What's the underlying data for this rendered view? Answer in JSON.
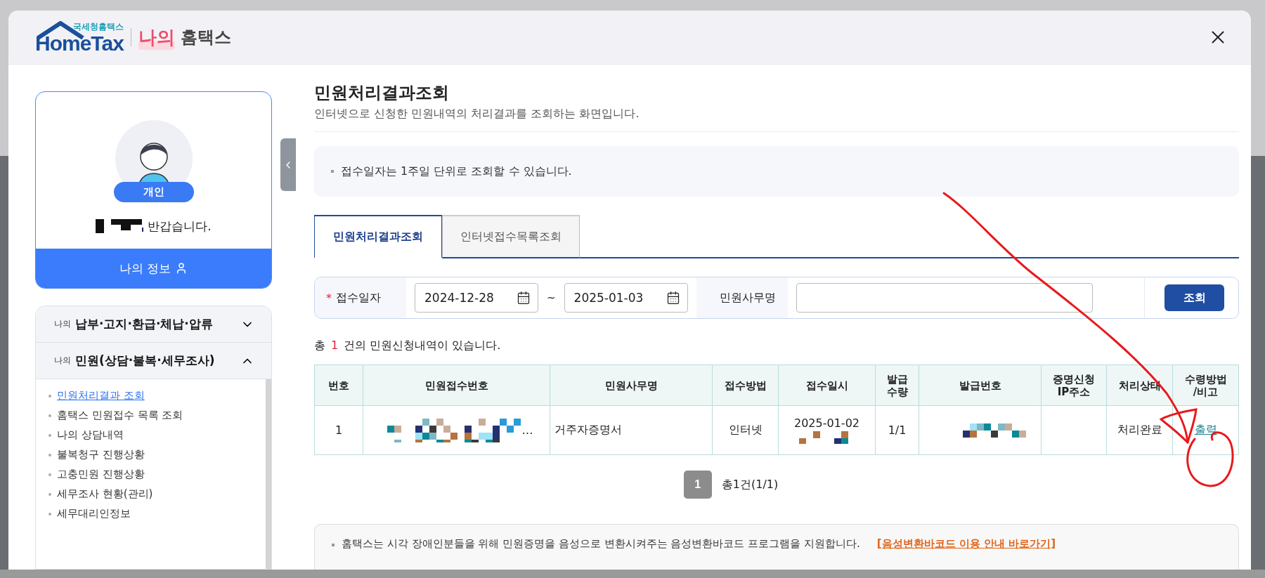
{
  "header": {
    "logo_caption": "국세청홈택스",
    "logo_text": "HomeTax",
    "brand_highlight": "나의",
    "brand_title": "홈택스"
  },
  "profile": {
    "badge": "개인",
    "greeting": "반갑습니다.",
    "my_info_button": "나의 정보"
  },
  "menu": [
    {
      "prefix": "나의",
      "title": "납부·고지·환급·체납·압류",
      "expanded": false
    },
    {
      "prefix": "나의",
      "title": "민원(상담·불복·세무조사)",
      "expanded": true,
      "items": [
        {
          "label": "민원처리결과 조회",
          "selected": true
        },
        {
          "label": "홈택스 민원접수 목록 조회",
          "selected": false
        },
        {
          "label": "나의 상담내역",
          "selected": false
        },
        {
          "label": "불복청구 진행상황",
          "selected": false
        },
        {
          "label": "고충민원 진행상황",
          "selected": false
        },
        {
          "label": "세무조사 현황(관리)",
          "selected": false
        },
        {
          "label": "세무대리인정보",
          "selected": false
        }
      ]
    }
  ],
  "page": {
    "title": "민원처리결과조회",
    "subtitle": "인터넷으로 신청한 민원내역의 처리결과를 조회하는 화면입니다."
  },
  "notice": "접수일자는 1주일 단위로 조회할 수 있습니다.",
  "tabs": [
    {
      "label": "민원처리결과조회",
      "selected": true
    },
    {
      "label": "인터넷접수목록조회",
      "selected": false
    }
  ],
  "search": {
    "date_label": "접수일자",
    "required_mark": "*",
    "date_from": "2024-12-28",
    "date_separator": "~",
    "date_to": "2025-01-03",
    "name_label": "민원사무명",
    "button": "조회"
  },
  "result_count": {
    "prefix": "총",
    "count": "1",
    "suffix": "건의 민원신청내역이 있습니다."
  },
  "table": {
    "columns": [
      "번호",
      "민원접수번호",
      "민원사무명",
      "접수방법",
      "접수일시",
      "발급\n수량",
      "발급번호",
      "증명신청\nIP주소",
      "처리상태",
      "수령방법\n/비고"
    ],
    "rows": [
      {
        "number": "1",
        "receipt_number": "…",
        "service_name": "거주자증명서",
        "method": "인터넷",
        "received_at": "2025-01-02",
        "quantity": "1/1",
        "status": "처리완료",
        "action": "출력"
      }
    ]
  },
  "pagination": {
    "pages": [
      {
        "label": "1",
        "selected": true
      }
    ],
    "summary": "총1건(1/1)"
  },
  "footer_notice": {
    "text": "홈택스는 시각 장애인분들을 위해 민원증명을 음성으로 변환시켜주는 음성변환바코드 프로그램을 지원합니다.",
    "link": "[음성변환바코드 이용 안내 바로가기]"
  }
}
